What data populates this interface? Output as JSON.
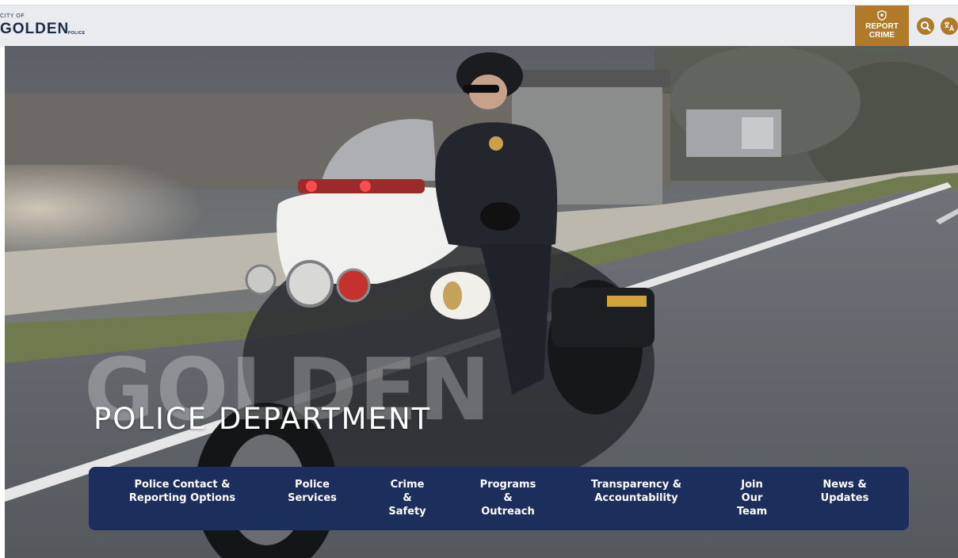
{
  "header": {
    "logo": {
      "small_text": "CITY OF",
      "main_text": "GOLDEN",
      "sub_text": "POLICE"
    },
    "report_crime": {
      "icon": "shield-icon",
      "line1": "REPORT",
      "line2": "CRIME"
    },
    "search_icon": "search-icon",
    "translate_icon": "translate-icon",
    "accent_color": "#b07a2a"
  },
  "hero": {
    "watermark": "GOLDEN",
    "title": "POLICE DEPARTMENT"
  },
  "nav": {
    "background_color": "#1c2e5c",
    "items": [
      {
        "lines": [
          "Police Contact &",
          "Reporting Options"
        ]
      },
      {
        "lines": [
          "Police",
          "Services"
        ]
      },
      {
        "lines": [
          "Crime",
          "&",
          "Safety"
        ]
      },
      {
        "lines": [
          "Programs",
          "&",
          "Outreach"
        ]
      },
      {
        "lines": [
          "Transparency &",
          "Accountability"
        ]
      },
      {
        "lines": [
          "Join",
          "Our",
          "Team"
        ]
      },
      {
        "lines": [
          "News &",
          "Updates"
        ]
      }
    ]
  }
}
